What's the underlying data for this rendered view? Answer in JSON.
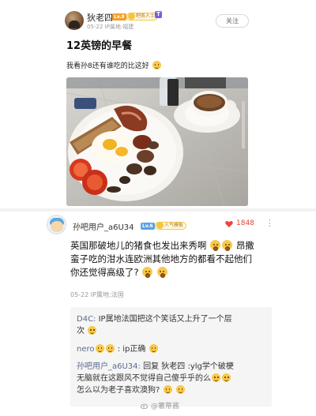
{
  "post": {
    "username": "狄老四",
    "level": "Lv.8",
    "crown_badge": "吧务人士",
    "t_badge": "T",
    "meta": "05-22  IP属地:福建",
    "follow_label": "关注",
    "title": "12英镑的早餐",
    "body": "我看孙8还有谁吃的比这好"
  },
  "comment": {
    "username": "孙吧用户_a6U34",
    "level": "Lv.6",
    "badge": "人气模板",
    "likes": "1848",
    "more": "⋮",
    "line1": "英国那破地儿的猪食也发出来秀啊",
    "line1b": "昂撒",
    "line2": "蛮子吃的泔水连欧洲其他地方的都看不起他们",
    "line3": "你还觉得高级了?",
    "meta": "05-22  IP属地:法国"
  },
  "replies": [
    {
      "name": "D4C:",
      "text": "IP属地法国把这个笑话又上升了一个层",
      "text2": "次"
    },
    {
      "name": "nero",
      "text": ": ip正确"
    },
    {
      "name": "孙吧用户_a6U34:",
      "text": "回复 狄老四 :ylg学个破梗",
      "text2": "无脑就在这跟风不觉得自己傻乎乎的么",
      "text3": "怎么以为老子喜欢澳狗?"
    }
  ],
  "watermark": "@薯蒂酱"
}
